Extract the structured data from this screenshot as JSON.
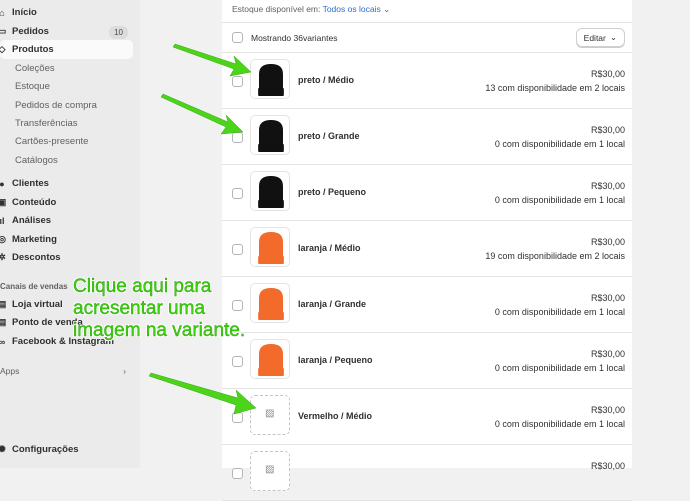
{
  "sidebar": {
    "items": [
      {
        "label": "Início",
        "icon": "home-icon"
      },
      {
        "label": "Pedidos",
        "icon": "inbox-icon",
        "badge": "10"
      },
      {
        "label": "Produtos",
        "icon": "tag-icon"
      }
    ],
    "sub_items": [
      "Coleções",
      "Estoque",
      "Pedidos de compra",
      "Transferências",
      "Cartões-presente",
      "Catálogos"
    ],
    "items2": [
      {
        "label": "Clientes",
        "icon": "person-icon"
      },
      {
        "label": "Conteúdo",
        "icon": "content-icon"
      },
      {
        "label": "Análises",
        "icon": "chart-icon"
      },
      {
        "label": "Marketing",
        "icon": "target-icon"
      },
      {
        "label": "Descontos",
        "icon": "discount-icon"
      }
    ],
    "channels_title": "Canais de vendas",
    "channels": [
      {
        "label": "Loja virtual",
        "icon": "store-icon"
      },
      {
        "label": "Ponto de venda",
        "icon": "pos-icon"
      },
      {
        "label": "Facebook & Instagram",
        "icon": "meta-icon"
      }
    ],
    "apps": "Apps",
    "settings": "Configurações"
  },
  "main": {
    "filter_label": "Estoque disponível em:",
    "filter_value": "Todos os locais",
    "showing": "Mostrando 36variantes",
    "edit": "Editar",
    "variants": [
      {
        "name": "preto / Médio",
        "price": "R$30,00",
        "avail": "13 com disponibilidade em 2 locais",
        "color": "#111111"
      },
      {
        "name": "preto / Grande",
        "price": "R$30,00",
        "avail": "0 com disponibilidade em 1 local",
        "color": "#111111"
      },
      {
        "name": "preto / Pequeno",
        "price": "R$30,00",
        "avail": "0 com disponibilidade em 1 local",
        "color": "#111111"
      },
      {
        "name": "laranja / Médio",
        "price": "R$30,00",
        "avail": "19 com disponibilidade em 2 locais",
        "color": "#f26b2a"
      },
      {
        "name": "laranja / Grande",
        "price": "R$30,00",
        "avail": "0 com disponibilidade em 1 local",
        "color": "#f26b2a"
      },
      {
        "name": "laranja / Pequeno",
        "price": "R$30,00",
        "avail": "0 com disponibilidade em 1 local",
        "color": "#f26b2a"
      },
      {
        "name": "Vermelho / Médio",
        "price": "R$30,00",
        "avail": "0 com disponibilidade em 1 local",
        "color": null
      },
      {
        "name": "",
        "price": "R$30,00",
        "avail": "",
        "color": null
      }
    ]
  },
  "annotation": {
    "lines": [
      "Clique aqui para",
      "acresentar uma",
      "imagem na variante."
    ],
    "color": "#3ed10e"
  }
}
